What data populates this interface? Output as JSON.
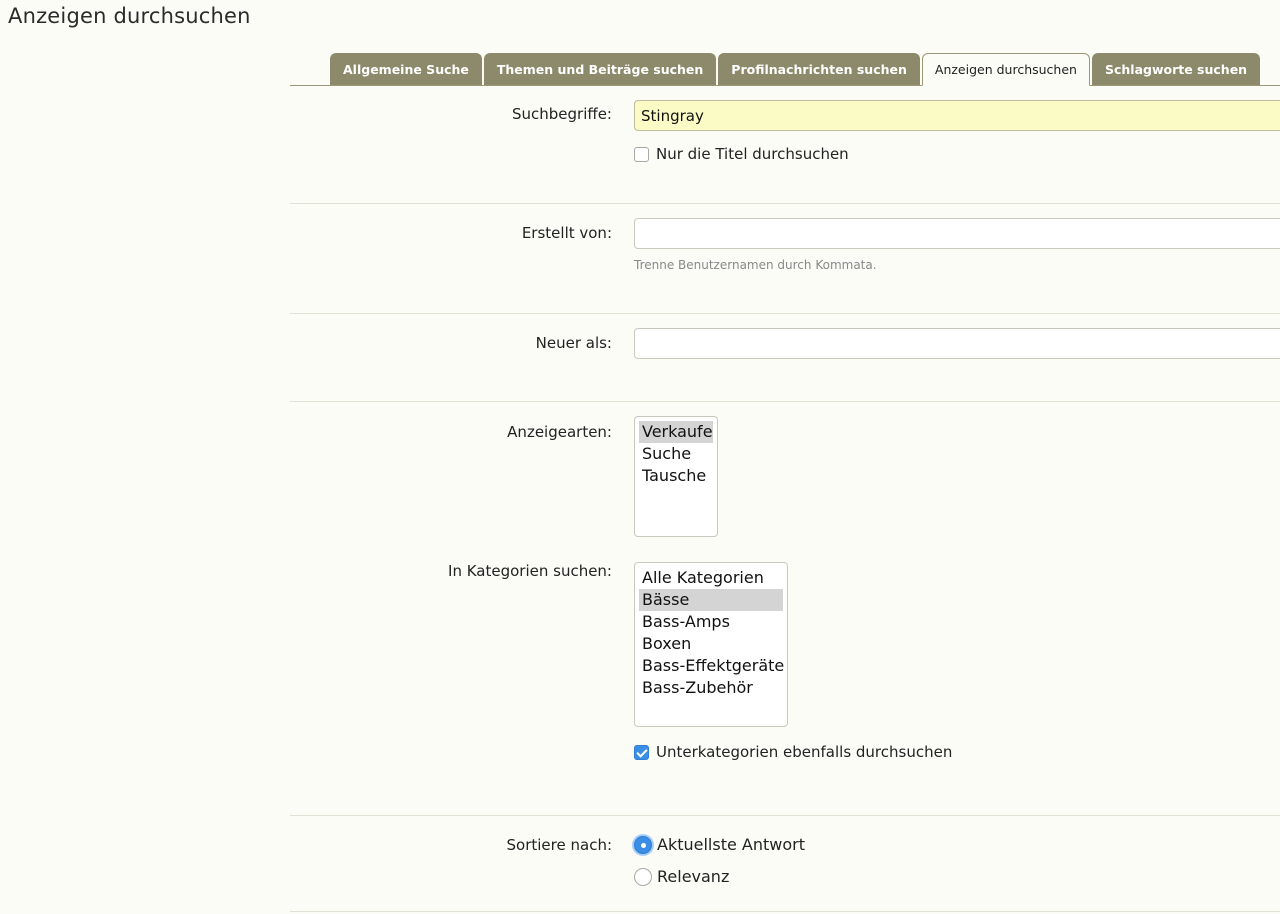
{
  "page": {
    "title": "Anzeigen durchsuchen"
  },
  "tabs": [
    {
      "label": "Allgemeine Suche",
      "active": false
    },
    {
      "label": "Themen und Beiträge suchen",
      "active": false
    },
    {
      "label": "Profilnachrichten suchen",
      "active": false
    },
    {
      "label": "Anzeigen durchsuchen",
      "active": true
    },
    {
      "label": "Schlagworte suchen",
      "active": false
    }
  ],
  "search_terms": {
    "label": "Suchbegriffe:",
    "value": "Stingray",
    "titles_only_label": "Nur die Titel durchsuchen",
    "titles_only_checked": false
  },
  "created_by": {
    "label": "Erstellt von:",
    "value": "",
    "hint": "Trenne Benutzernamen durch Kommata."
  },
  "newer_than": {
    "label": "Neuer als:",
    "value": ""
  },
  "ad_types": {
    "label": "Anzeigearten:",
    "options": [
      {
        "label": "Verkaufe",
        "selected": true
      },
      {
        "label": "Suche",
        "selected": false
      },
      {
        "label": "Tausche",
        "selected": false
      }
    ]
  },
  "categories": {
    "label": "In Kategorien suchen:",
    "options": [
      {
        "label": "Alle Kategorien",
        "selected": false
      },
      {
        "label": "Bässe",
        "selected": true
      },
      {
        "label": "Bass-Amps",
        "selected": false
      },
      {
        "label": "Boxen",
        "selected": false
      },
      {
        "label": "Bass-Effektgeräte",
        "selected": false
      },
      {
        "label": "Bass-Zubehör",
        "selected": false
      }
    ],
    "include_sub_label": "Unterkategorien ebenfalls durchsuchen",
    "include_sub_checked": true
  },
  "sort": {
    "label": "Sortiere nach:",
    "options": [
      {
        "label": "Aktuellste Antwort",
        "checked": true
      },
      {
        "label": "Relevanz",
        "checked": false
      }
    ]
  },
  "colors": {
    "tab_bg": "#8c8a6a",
    "page_bg": "#fcfcf7",
    "input_highlight": "#fbfbc5",
    "accent": "#3a8ee6"
  }
}
